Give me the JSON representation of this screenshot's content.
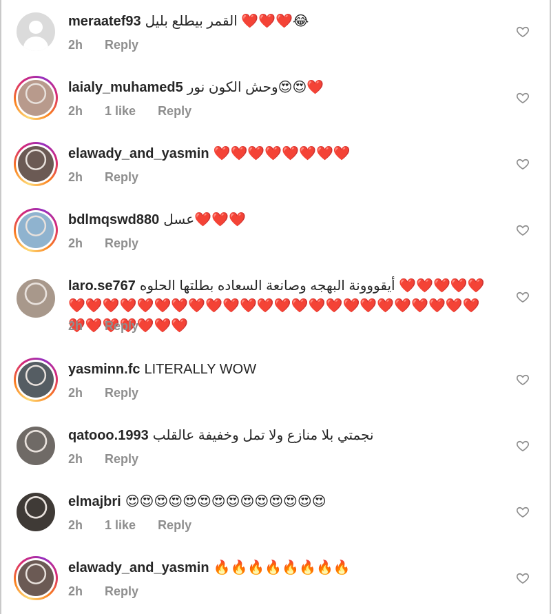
{
  "comments": [
    {
      "username": "meraatef93",
      "text": "القمر بيطلع بليل ❤️❤️❤️😂",
      "time": "2h",
      "likes": "",
      "reply": "Reply",
      "avatar": "default",
      "ring": false,
      "photo_color": "#cfcfcf"
    },
    {
      "username": "laialy_muhamed5",
      "text": "وحش الكون نور😍😍❤️",
      "time": "2h",
      "likes": "1 like",
      "reply": "Reply",
      "avatar": "photo",
      "ring": true,
      "photo_color": "#b89a8c"
    },
    {
      "username": "elawady_and_yasmin",
      "text": "❤️❤️❤️❤️❤️❤️❤️❤️",
      "time": "2h",
      "likes": "",
      "reply": "Reply",
      "avatar": "photo",
      "ring": true,
      "photo_color": "#6b5a54"
    },
    {
      "username": "bdlmqswd880",
      "text": "عسل❤️❤️❤️",
      "time": "2h",
      "likes": "",
      "reply": "Reply",
      "avatar": "photo",
      "ring": true,
      "photo_color": "#8fb3cf"
    },
    {
      "username": "laro.se767",
      "text": "أيقووونة البهجه وصانعة السعاده بطلتها الحلوه ❤️❤️❤️❤️❤️❤️❤️❤️❤️❤️❤️❤️❤️❤️❤️❤️❤️❤️❤️❤️❤️❤️❤️❤️❤️❤️❤️❤️❤️❤️❤️❤️❤️❤️❤️❤️",
      "time": "2h",
      "likes": "",
      "reply": "Reply",
      "avatar": "photo",
      "ring": false,
      "photo_color": "#a8988b"
    },
    {
      "username": "yasminn.fc",
      "text": "LITERALLY WOW",
      "time": "2h",
      "likes": "",
      "reply": "Reply",
      "avatar": "photo",
      "ring": true,
      "photo_color": "#555d63"
    },
    {
      "username": "qatooo.1993",
      "text": "نجمتي بلا منازع ولا تمل وخفيفة عالقلب",
      "time": "2h",
      "likes": "",
      "reply": "Reply",
      "avatar": "photo",
      "ring": false,
      "photo_color": "#6f6a66"
    },
    {
      "username": "elmajbri",
      "text": "😍😍😍😍😍😍😍😍😍😍😍😍😍😍",
      "time": "2h",
      "likes": "1 like",
      "reply": "Reply",
      "avatar": "photo",
      "ring": false,
      "photo_color": "#3f3a36"
    },
    {
      "username": "elawady_and_yasmin",
      "text": "🔥🔥🔥🔥🔥🔥🔥🔥",
      "time": "2h",
      "likes": "",
      "reply": "Reply",
      "avatar": "photo",
      "ring": true,
      "photo_color": "#6b5a54"
    }
  ],
  "colors": {
    "text": "#262626",
    "meta": "#8e8e8e",
    "heart_outline": "#8e8e8e",
    "ring_gradient": [
      "#feda75",
      "#fa7e1e",
      "#d62976",
      "#962fbf"
    ]
  },
  "icons": {
    "like": "heart-outline-icon",
    "avatar_default": "user-silhouette-icon"
  }
}
